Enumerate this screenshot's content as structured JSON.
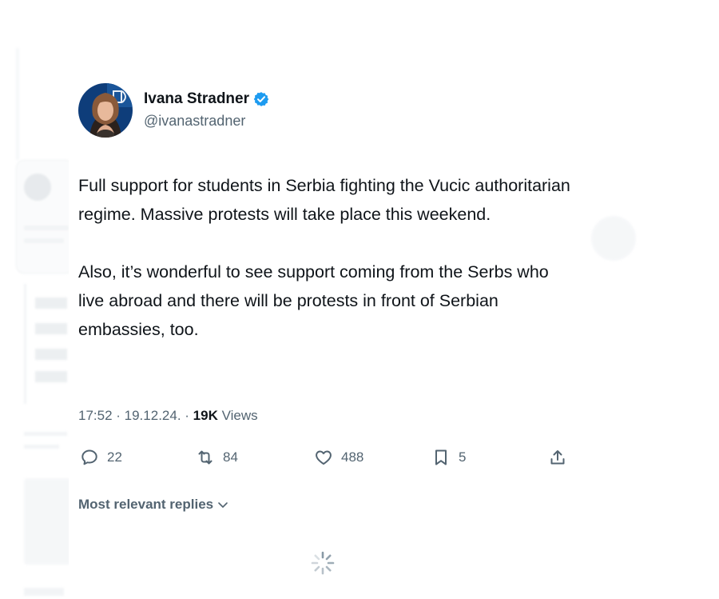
{
  "tweet": {
    "author_name": "Ivana Stradner",
    "handle": "@ivanastradner",
    "paragraphs": [
      "Full support for students in Serbia fighting the Vucic authoritarian regime. Massive protests will take place this weekend.",
      "Also, it’s wonderful to see support coming from the Serbs who live abroad and there will be protests in front of Serbian embassies, too."
    ],
    "timestamp": "17:52 · 19.12.24.",
    "separator": " · ",
    "views_count": "19K",
    "views_label": "Views"
  },
  "actions": {
    "replies": "22",
    "reposts": "84",
    "likes": "488",
    "bookmarks": "5"
  },
  "replies_sort": {
    "label": "Most relevant replies"
  },
  "icons": {
    "verified": "verified-badge-icon",
    "reply": "reply-icon",
    "repost": "repost-icon",
    "like": "heart-icon",
    "bookmark": "bookmark-icon",
    "share": "share-icon",
    "chevron": "chevron-down-icon",
    "loading": "loading-spinner-icon"
  },
  "colors": {
    "verified": "#1d9bf0",
    "text_primary": "#0f1419",
    "text_secondary": "#536471"
  }
}
